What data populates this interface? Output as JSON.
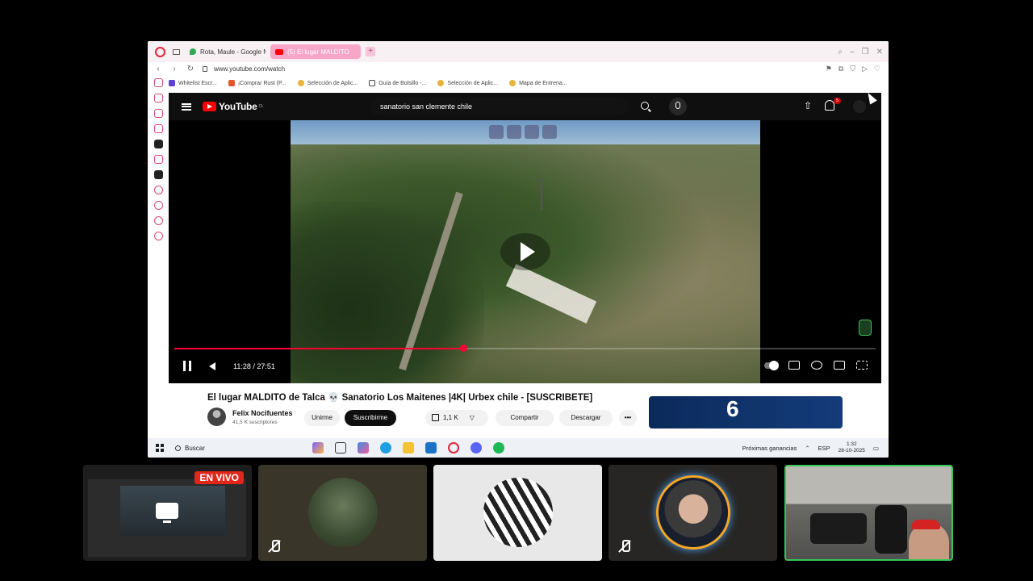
{
  "browser": {
    "tabs": [
      {
        "label": "Rota, Maule - Google Ma"
      },
      {
        "label": "(5) El lugar MALDITO"
      }
    ],
    "address": "www.youtube.com/watch",
    "bookmarks": [
      {
        "label": "Whitelist Escr...",
        "color": "#5b3fd6"
      },
      {
        "label": "¡Comprar Rust (P...",
        "color": "#e2572a"
      },
      {
        "label": "Selección de Aplic...",
        "color": "#e8b339"
      },
      {
        "label": "Guía de Bolsillo -...",
        "color": "#444444"
      },
      {
        "label": "Selección de Aplic...",
        "color": "#e8b339"
      },
      {
        "label": "Mapa de Entrena...",
        "color": "#e8b339"
      }
    ]
  },
  "youtube": {
    "logo_text": "YouTube",
    "logo_country": "CL",
    "search_query": "sanatorio san clemente chile",
    "notifications_count": "5",
    "player": {
      "time": "11:28 / 27:51",
      "progress": 0.412
    },
    "video_title": "El lugar MALDITO de Talca 💀 Sanatorio Los Maitenes |4K| Urbex chile - [SUSCRIBETE]",
    "channel_name": "Felix Nocifuentes",
    "subscribers": "41,5 K suscriptores",
    "join_label": "Unirme",
    "subscribe_label": "Suscribirme",
    "likes": "1,1 K",
    "share_label": "Compartir",
    "download_label": "Descargar",
    "more_label": "•••",
    "ad_number": "6"
  },
  "taskbar": {
    "search_placeholder": "Buscar",
    "widget": "Próximas ganancias",
    "language": "ESP",
    "time": "1:32",
    "date": "28-10-2025"
  },
  "call": {
    "live_badge": "EN VIVO"
  }
}
